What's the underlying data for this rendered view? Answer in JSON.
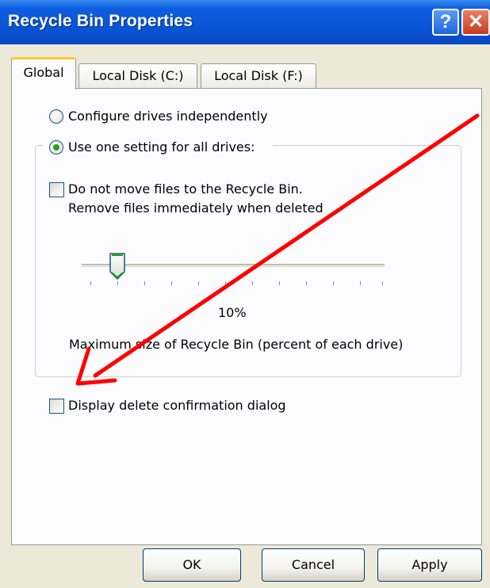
{
  "window": {
    "title": "Recycle Bin Properties",
    "help_glyph": "?",
    "close_glyph": "✕"
  },
  "tabs": [
    {
      "label": "Global",
      "active": true
    },
    {
      "label": "Local Disk (C:)",
      "active": false
    },
    {
      "label": "Local Disk (F:)",
      "active": false
    }
  ],
  "settings": {
    "radio_independent_label": "Configure drives independently",
    "radio_independent_selected": false,
    "radio_one_setting_label": "Use one setting for all drives:",
    "radio_one_setting_selected": true,
    "do_not_move_line1": "Do not move files to the Recycle Bin.",
    "do_not_move_line2": "Remove files immediately when deleted",
    "do_not_move_checked": false,
    "slider_value_label": "10%",
    "slider_value_percent": 10,
    "slider_caption": "Maximum size of Recycle Bin (percent of each drive)",
    "display_confirm_label": "Display delete confirmation dialog",
    "display_confirm_checked": false
  },
  "buttons": {
    "ok": "OK",
    "cancel": "Cancel",
    "apply": "Apply"
  },
  "colors": {
    "titlebar": "#0a55d6",
    "annotation_arrow": "#ff0000",
    "radio_dot": "#21a121",
    "active_tab_accent": "#ffc83c"
  },
  "icons": [
    "help-icon",
    "close-icon",
    "slider-thumb-icon",
    "red-arrow-annotation"
  ]
}
